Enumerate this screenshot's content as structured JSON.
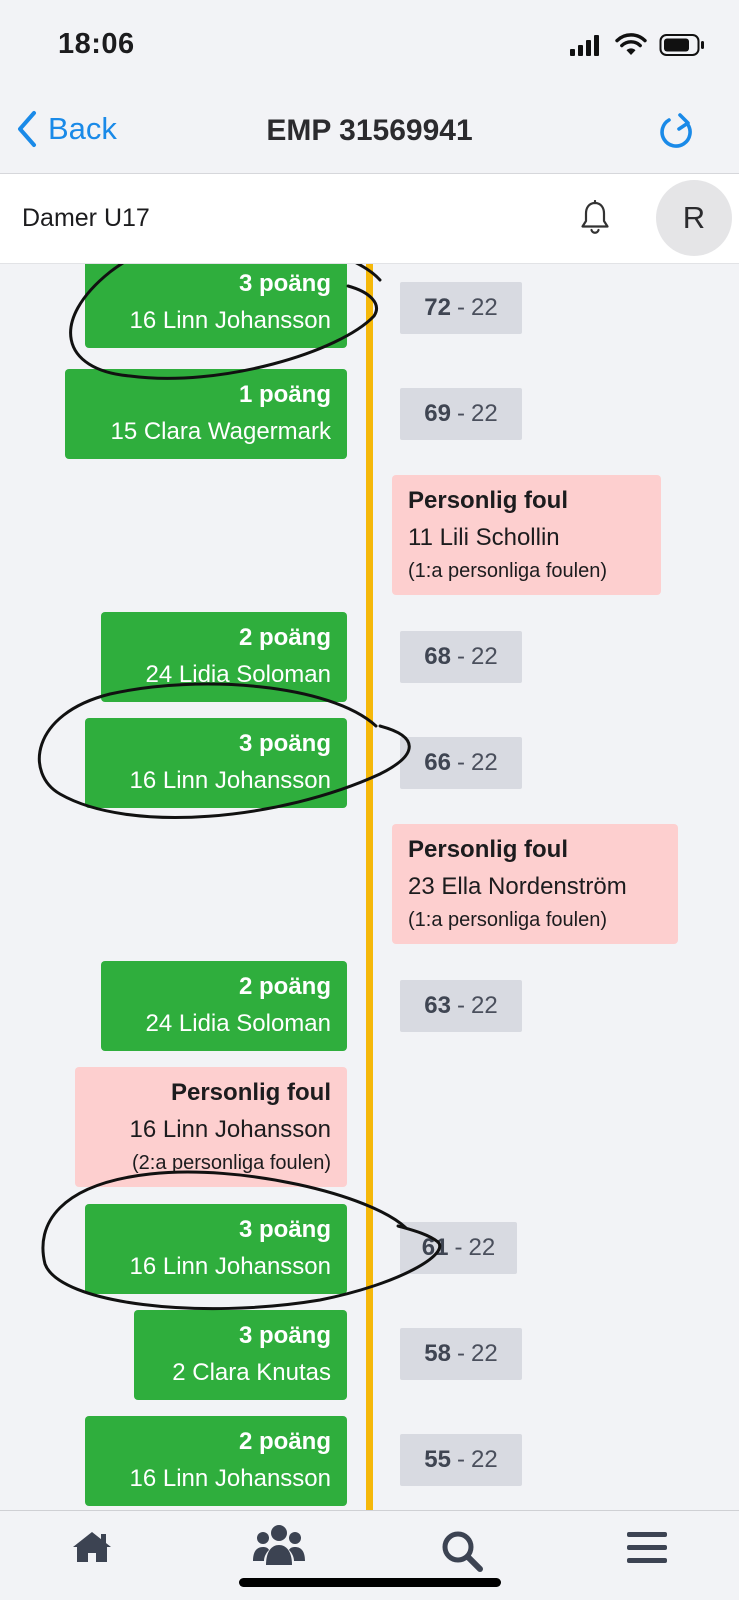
{
  "status": {
    "time": "18:06"
  },
  "nav": {
    "back_label": "Back",
    "title": "EMP 31569941"
  },
  "header": {
    "team": "Damer U17",
    "avatar_initial": "R"
  },
  "events": [
    {
      "side": "left",
      "type": "score",
      "title": "3 poäng",
      "player": "16 Linn Johansson"
    },
    {
      "side": "left",
      "type": "score",
      "title": "1 poäng",
      "player": "15 Clara Wagermark"
    },
    {
      "side": "right",
      "type": "foul",
      "title": "Personlig foul",
      "player": "11 Lili Schollin",
      "note": "(1:a personliga foulen)"
    },
    {
      "side": "left",
      "type": "score",
      "title": "2 poäng",
      "player": "24 Lidia Soloman"
    },
    {
      "side": "left",
      "type": "score",
      "title": "3 poäng",
      "player": "16 Linn Johansson"
    },
    {
      "side": "right",
      "type": "foul",
      "title": "Personlig foul",
      "player": "23 Ella Nordenström",
      "note": "(1:a personliga foulen)"
    },
    {
      "side": "left",
      "type": "score",
      "title": "2 poäng",
      "player": "24 Lidia Soloman"
    },
    {
      "side": "left",
      "type": "foul",
      "title": "Personlig foul",
      "player": "16 Linn Johansson",
      "note": "(2:a personliga foulen)"
    },
    {
      "side": "left",
      "type": "score",
      "title": "3 poäng",
      "player": "16 Linn Johansson"
    },
    {
      "side": "left",
      "type": "score",
      "title": "3 poäng",
      "player": "2 Clara Knutas"
    },
    {
      "side": "left",
      "type": "score",
      "title": "2 poäng",
      "player": "16 Linn Johansson"
    }
  ],
  "scores": [
    {
      "home": "72",
      "sep": "-",
      "away": "22"
    },
    {
      "home": "69",
      "sep": "-",
      "away": "22"
    },
    {
      "home": "68",
      "sep": "-",
      "away": "22"
    },
    {
      "home": "66",
      "sep": "-",
      "away": "22"
    },
    {
      "home": "63",
      "sep": "-",
      "away": "22"
    },
    {
      "home": "61",
      "sep": "-",
      "away": "22"
    },
    {
      "home": "58",
      "sep": "-",
      "away": "22"
    },
    {
      "home": "55",
      "sep": "-",
      "away": "22"
    }
  ],
  "tabs": [
    {
      "name": "home",
      "icon": "house-icon"
    },
    {
      "name": "teams",
      "icon": "users-icon"
    },
    {
      "name": "search",
      "icon": "magnifier-icon"
    },
    {
      "name": "menu",
      "icon": "hamburger-menu-icon"
    }
  ],
  "colors": {
    "score_green": "#2fae3d",
    "foul_pink": "#fdcfcf",
    "timeline_yellow": "#f5b80a",
    "accent_blue": "#1a8ae8"
  }
}
